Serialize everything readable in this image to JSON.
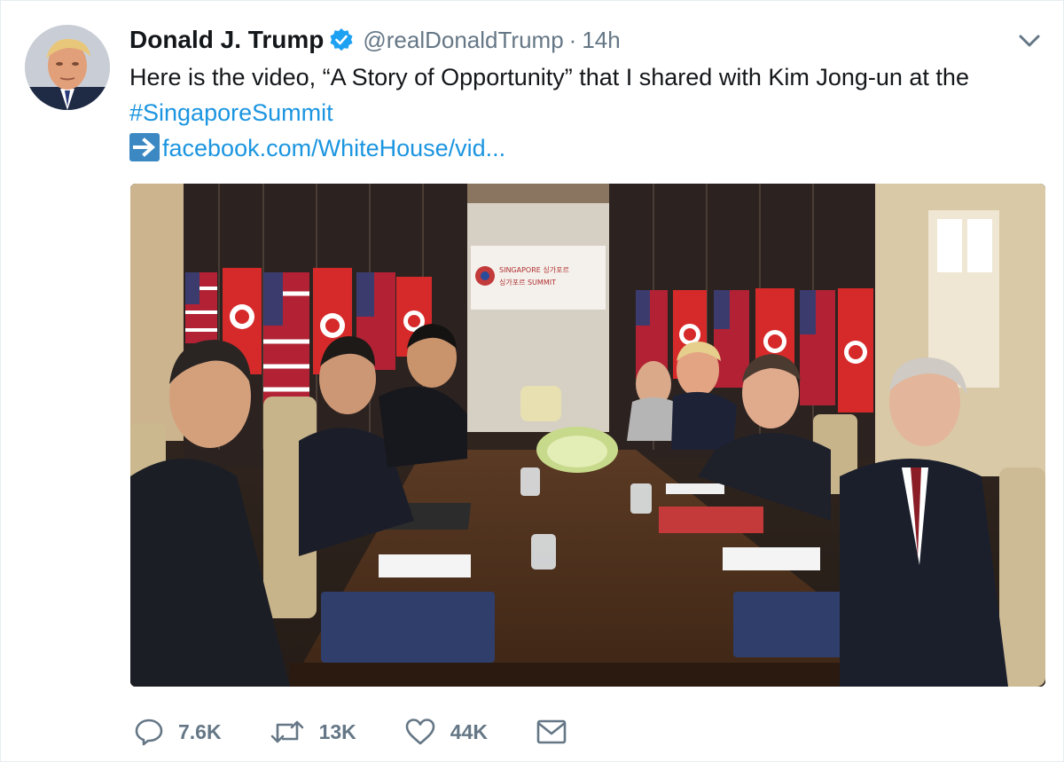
{
  "tweet": {
    "author_name": "Donald J. Trump",
    "handle": "@realDonaldTrump",
    "separator": "·",
    "time": "14h",
    "text_before_hashtag": "Here is the video, “A Story of Opportunity” that I shared with Kim Jong-un at the",
    "hashtag": "#SingaporeSummit",
    "link": "facebook.com/WhiteHouse/vid...",
    "photo_sign_text_1": "SINGAPORE 싱가포르",
    "photo_sign_text_2": "싱가포르 SUMMIT"
  },
  "actions": {
    "reply_count": "7.6K",
    "retweet_count": "13K",
    "like_count": "44K"
  },
  "icons": {
    "reply": "speech-bubble-icon",
    "retweet": "retweet-arrows-icon",
    "like": "heart-icon",
    "dm": "envelope-icon",
    "menu": "chevron-down-icon",
    "verified": "verified-badge-icon",
    "link_arrow": "right-arrow-icon"
  },
  "colors": {
    "link_blue": "#1b95e0",
    "verified_blue": "#1da1f2",
    "muted_gray": "#657786",
    "arrow_box": "#3b88c3"
  }
}
